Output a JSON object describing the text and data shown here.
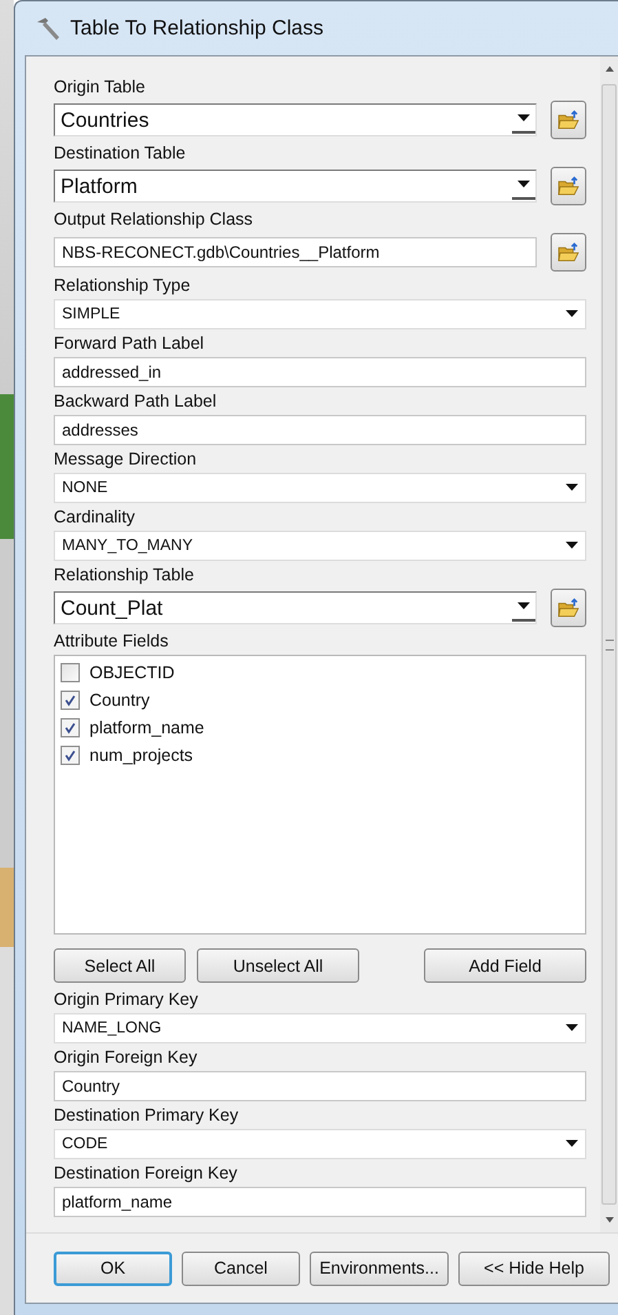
{
  "window": {
    "title": "Table To Relationship Class"
  },
  "parameters": [
    {
      "label": "Origin Table",
      "kind": "table",
      "value": "Countries"
    },
    {
      "label": "Destination Table",
      "kind": "table",
      "value": "Platform"
    },
    {
      "label": "Output Relationship Class",
      "kind": "output",
      "value": "NBS-RECONECT.gdb\\Countries__Platform"
    },
    {
      "label": "Relationship Type",
      "kind": "choice",
      "value": "SIMPLE"
    },
    {
      "label": "Forward Path Label",
      "kind": "text",
      "value": "addressed_in"
    },
    {
      "label": "Backward Path Label",
      "kind": "text",
      "value": "addresses"
    },
    {
      "label": "Message Direction",
      "kind": "choice",
      "value": "NONE"
    },
    {
      "label": "Cardinality",
      "kind": "choice",
      "value": "MANY_TO_MANY"
    },
    {
      "label": "Relationship Table",
      "kind": "table",
      "value": "Count_Plat"
    },
    {
      "label": "Attribute Fields",
      "kind": "checklist",
      "items": [
        {
          "label": "OBJECTID",
          "checked": false
        },
        {
          "label": "Country",
          "checked": true
        },
        {
          "label": "platform_name",
          "checked": true
        },
        {
          "label": "num_projects",
          "checked": true
        }
      ],
      "buttons": [
        "Select All",
        "Unselect All",
        "Add Field"
      ]
    },
    {
      "label": "Origin Primary Key",
      "kind": "choice",
      "value": "NAME_LONG"
    },
    {
      "label": "Origin Foreign Key",
      "kind": "text",
      "value": "Country"
    },
    {
      "label": "Destination Primary Key",
      "kind": "choice",
      "value": "CODE"
    },
    {
      "label": "Destination Foreign Key",
      "kind": "text",
      "value": "platform_name"
    }
  ],
  "buttons": [
    {
      "label": "OK",
      "focused": true
    },
    {
      "label": "Cancel",
      "focused": false
    },
    {
      "label": "Environments...",
      "focused": false
    },
    {
      "label": "<< Hide Help",
      "focused": false
    }
  ]
}
